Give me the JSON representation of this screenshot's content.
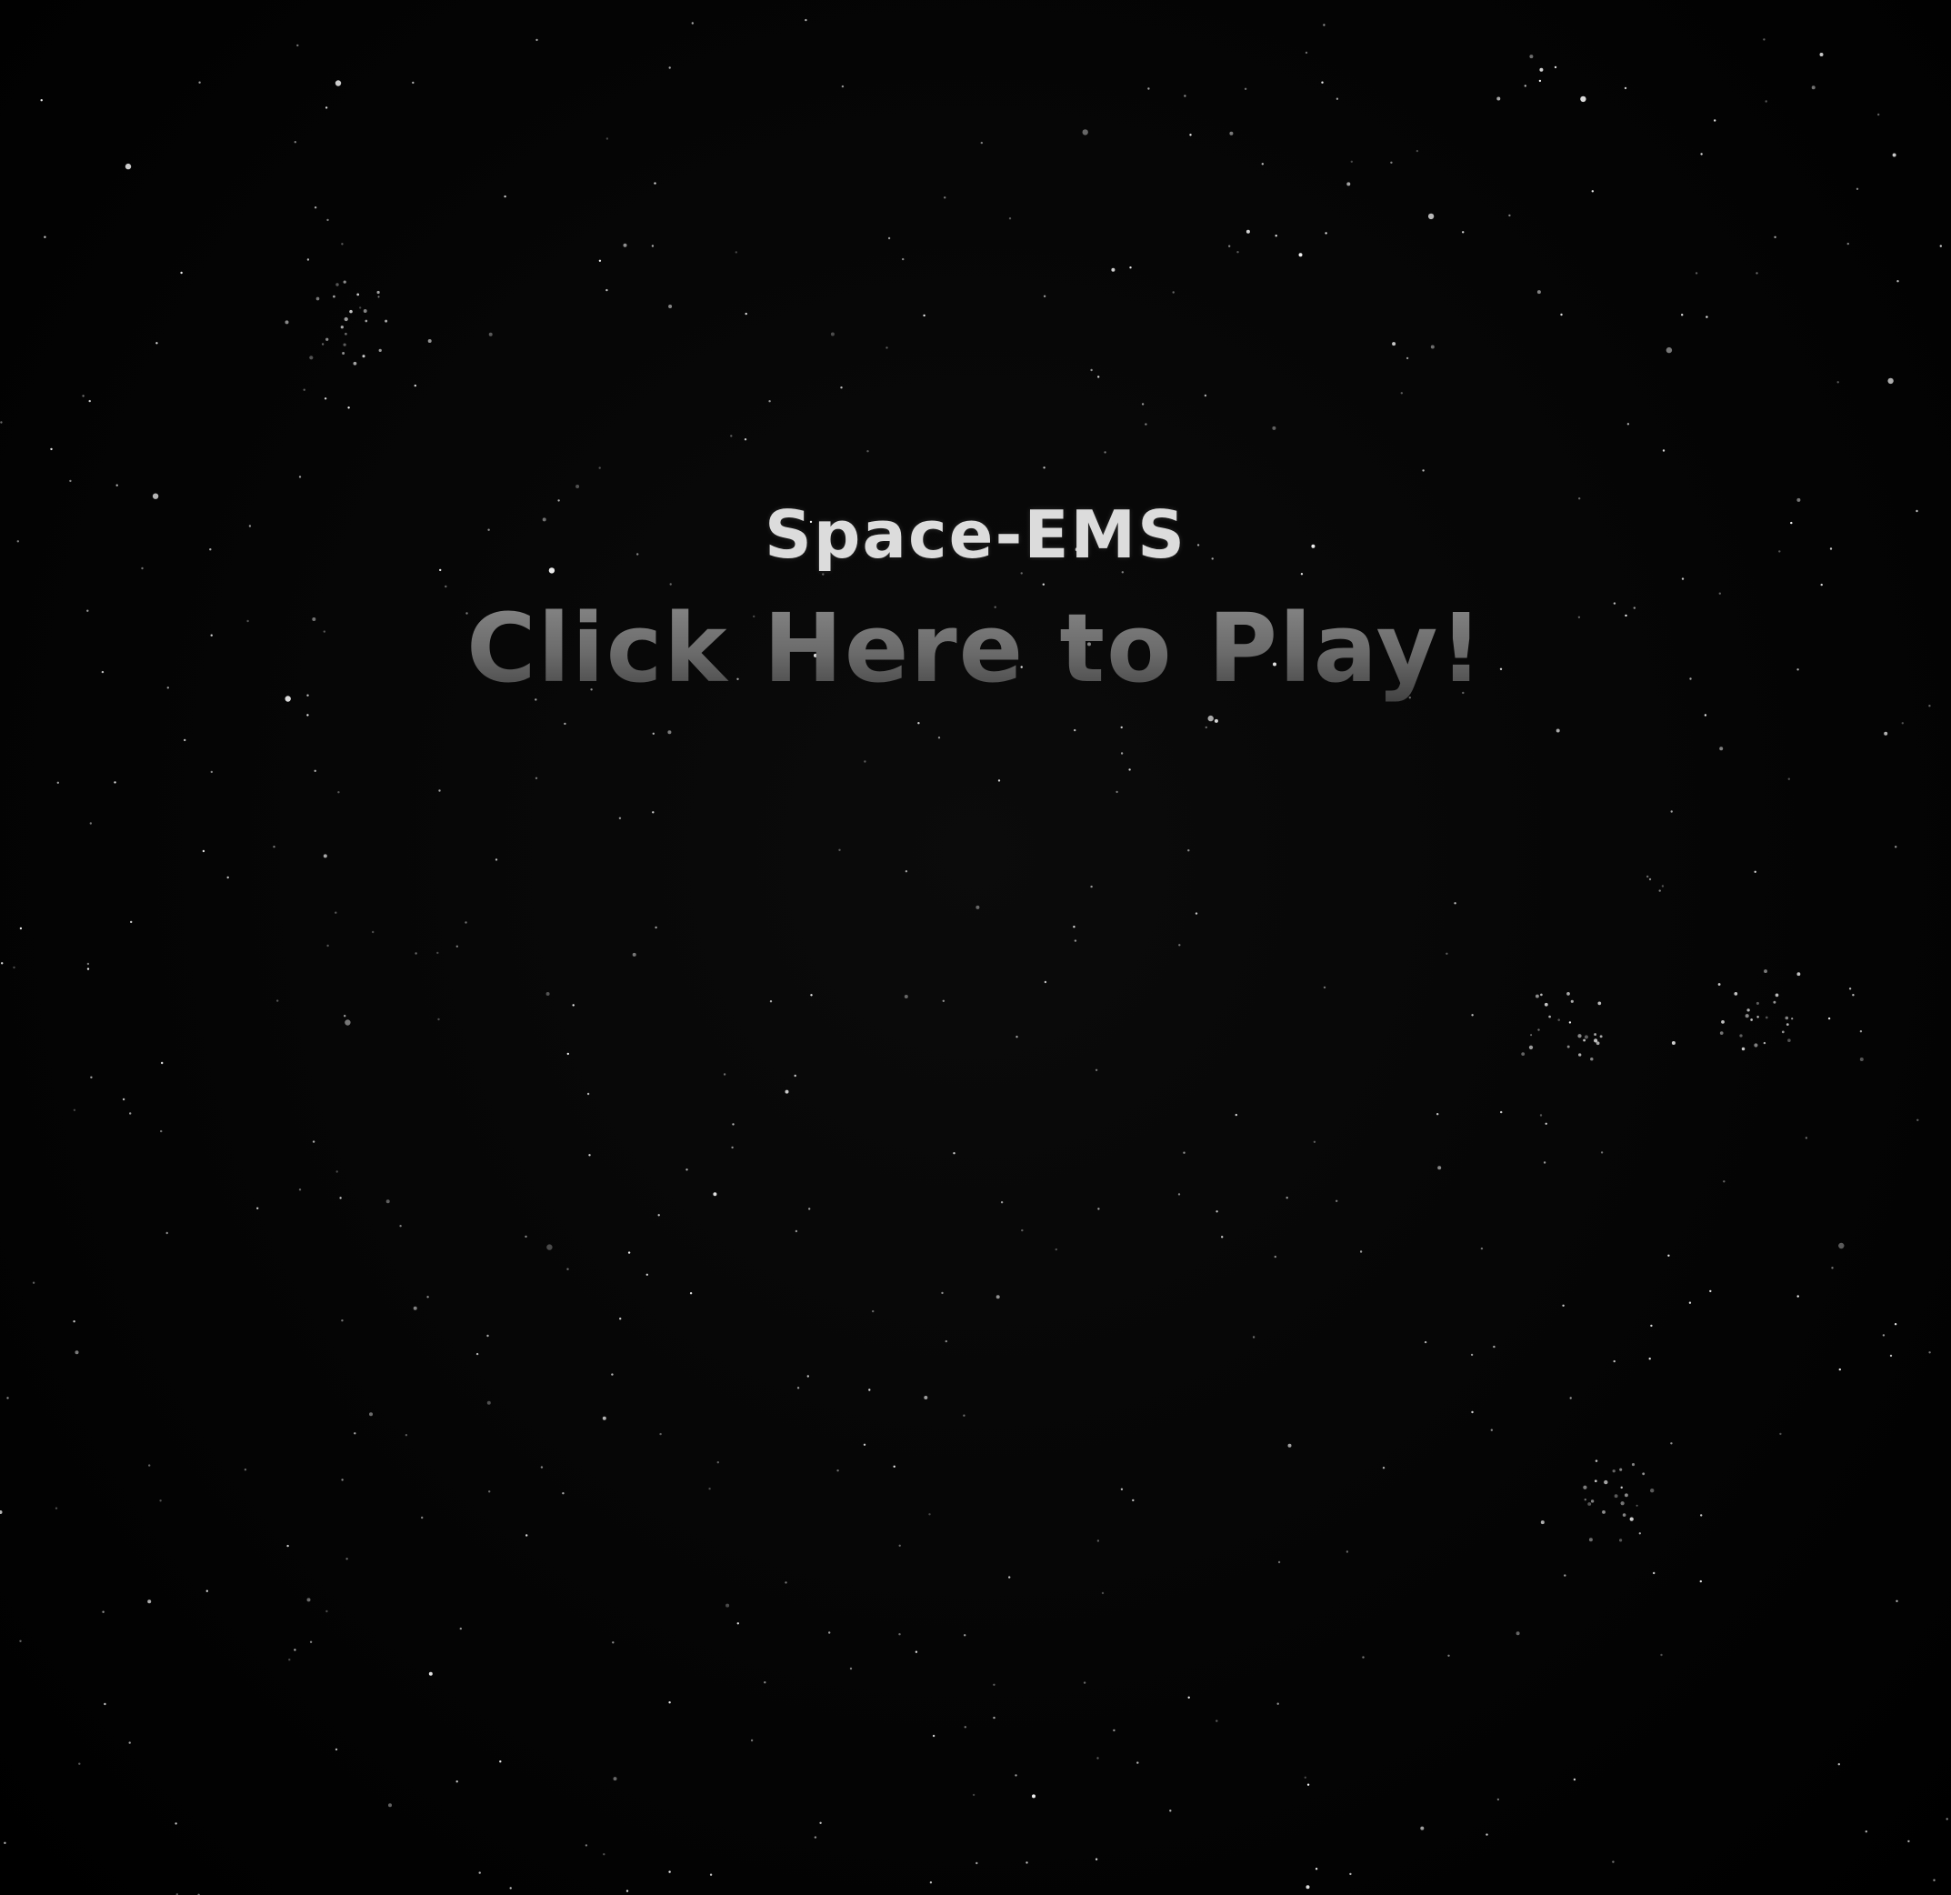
{
  "game": {
    "title": "Space-EMS",
    "play_label": "Click Here to Play!"
  },
  "colors": {
    "background": "#000000",
    "title": "#dcdcdc",
    "play_top": "#8c8c8c",
    "play_bottom": "#3e3e3e",
    "star": "#ffffff"
  }
}
